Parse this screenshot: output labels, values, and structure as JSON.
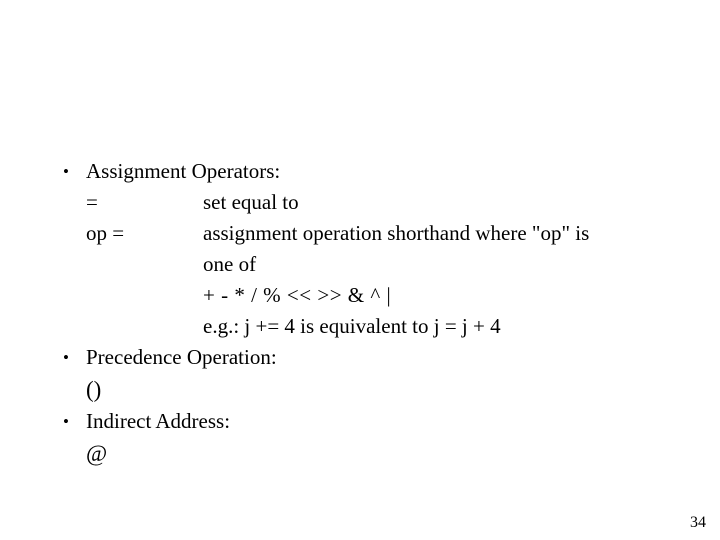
{
  "slide": {
    "title": "",
    "page_number": "34",
    "background_color": "#ffffff",
    "text_color": "#000000",
    "bullets": [
      {
        "marker": "•",
        "label": "Assignment Operators:",
        "rows": [
          {
            "label": "=",
            "desc": "set equal to"
          },
          {
            "label": "op =",
            "desc": "assignment operation shorthand where \"op\" is"
          }
        ],
        "continuation": "one of",
        "operators": "+ - * / % << >> & ^ |",
        "example": "e.g.: j += 4 is equivalent to j = j + 4"
      },
      {
        "marker": "•",
        "label": "Precedence Operation:",
        "symbol": "()"
      },
      {
        "marker": "•",
        "label": "Indirect Address:",
        "symbol": "@"
      }
    ]
  }
}
